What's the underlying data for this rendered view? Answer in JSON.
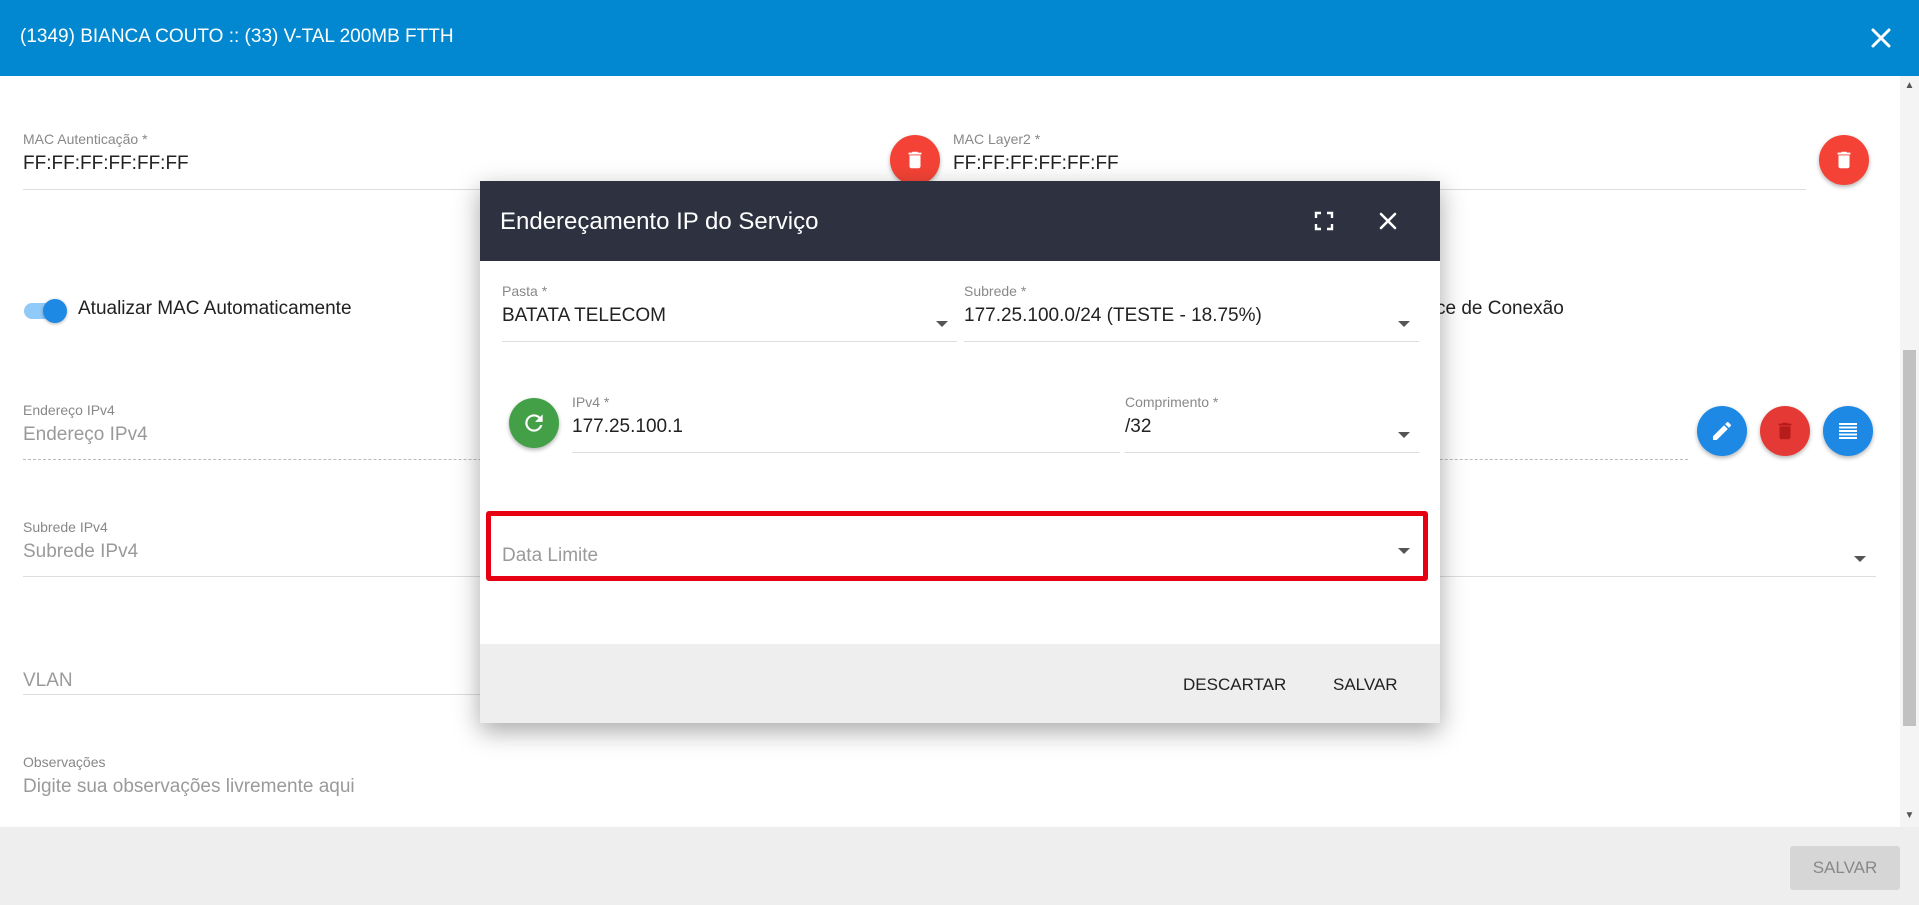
{
  "header": {
    "title": "(1349) BIANCA COUTO :: (33) V-TAL 200MB FTTH"
  },
  "form": {
    "mac_auth": {
      "label": "MAC Autenticação",
      "required_mark": "*",
      "value": "FF:FF:FF:FF:FF:FF"
    },
    "mac_layer2": {
      "label": "MAC Layer2",
      "required_mark": "*",
      "value": "FF:FF:FF:FF:FF:FF"
    },
    "auto_mac_toggle": {
      "label": "Atualizar MAC Automaticamente"
    },
    "partial_right_label": "ce de Conexão",
    "ipv4_address": {
      "label": "Endereço IPv4",
      "placeholder": "Endereço IPv4"
    },
    "ipv4_subnet": {
      "label": "Subrede IPv4",
      "placeholder": "Subrede IPv4"
    },
    "vlan": {
      "placeholder": "VLAN"
    },
    "notes": {
      "label": "Observações",
      "placeholder": "Digite sua observações livremente aqui"
    }
  },
  "footer": {
    "save_label": "SALVAR"
  },
  "dialog": {
    "title": "Endereçamento IP do Serviço",
    "pasta": {
      "label": "Pasta",
      "required_mark": "*",
      "value": "BATATA TELECOM"
    },
    "subrede": {
      "label": "Subrede",
      "required_mark": "*",
      "value": "177.25.100.0/24 (TESTE - 18.75%)"
    },
    "ipv4": {
      "label": "IPv4",
      "required_mark": "*",
      "value": "177.25.100.1"
    },
    "comprimento": {
      "label": "Comprimento",
      "required_mark": "*",
      "value": "/32"
    },
    "data_limite": {
      "placeholder": "Data Limite"
    },
    "discard_label": "DESCARTAR",
    "save_label": "SALVAR"
  },
  "colors": {
    "topbar": "#0288d1",
    "dialog_header": "#2e3240",
    "danger": "#f44336",
    "primary": "#1e88e5",
    "success": "#43a047",
    "highlight": "#e60012"
  }
}
